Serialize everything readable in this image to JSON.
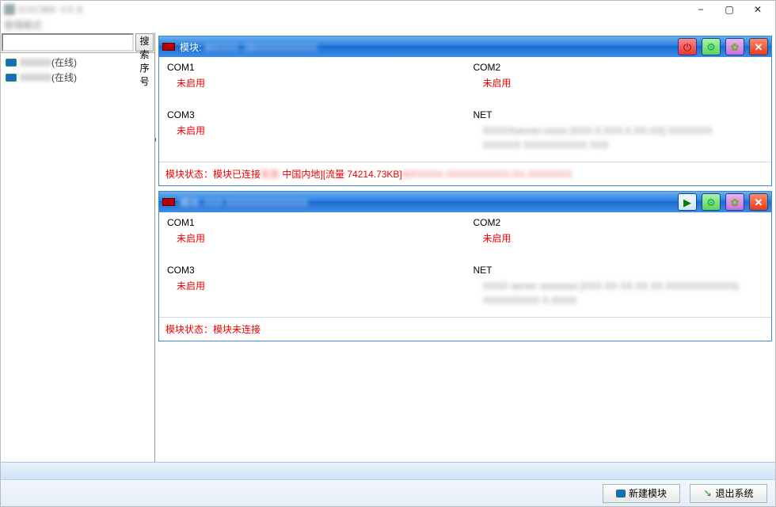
{
  "titlebar": {
    "app_title": "GXCMK V3.8"
  },
  "subbar": {
    "text": "管理模式"
  },
  "sidebar": {
    "search": {
      "placeholder": "",
      "button_label": "搜索序号"
    },
    "items": [
      {
        "serial": "XXXXX",
        "status": "(在线)"
      },
      {
        "serial": "XXXXX",
        "status": "(在线)"
      }
    ]
  },
  "common": {
    "not_enabled": "未启用",
    "com1": "COM1",
    "com2": "COM2",
    "com3": "COM3",
    "net": "NET",
    "module_prefix": "模块:"
  },
  "panels": [
    {
      "led": "red",
      "title_blur": "WXXXX: 28XXXXXXXXXX",
      "buttons": [
        "power",
        "gear",
        "globe",
        "close"
      ],
      "net_text_line1": "XXXXXserver-xxxxx    [XXX.X.XXX.X.XX-XX]  XXXXXXX",
      "net_text_line2": "XXXXXX  XXXXXXXXXX XXX",
      "status_prefix": "模块状态：模块已连接",
      "status_mid": " 中国内地][流量 74214.73KB]",
      "status_blur_a": "张某",
      "status_blur_b": "WXXXXX-XXXXXXXXXX-XX XXXXXXX"
    },
    {
      "led": "red",
      "title_blur": "模块: XXX XXXXXXXXXXXXX",
      "buttons": [
        "play",
        "gear",
        "globe",
        "close"
      ],
      "net_text_line1": "XXXX server xxxxxxxx  [XXX.XX XX.XX XX.XXXXXXXXXXX]",
      "net_text_line2": "XXXXXXXXX X.XXXX",
      "status_prefix": "模块状态：模块未连接",
      "status_mid": "",
      "status_blur_a": "",
      "status_blur_b": ""
    }
  ],
  "footer": {
    "new_module": "新建模块",
    "exit_system": "退出系统"
  }
}
